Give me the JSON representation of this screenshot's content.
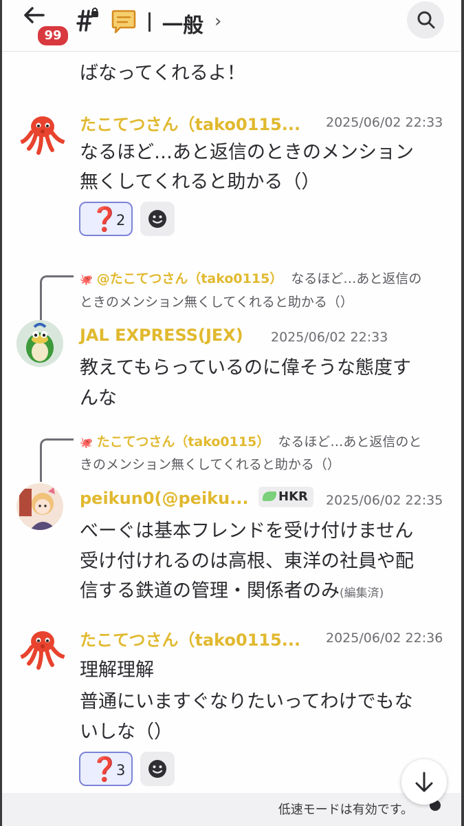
{
  "header": {
    "unread_badge": "99",
    "channel_name": "一般",
    "chevron": "›"
  },
  "messages": {
    "m0": {
      "tail": "ばなってくれるよ！"
    },
    "m1": {
      "username": "たこてつさん（tako0115...",
      "timestamp": "2025/06/02 22:33",
      "line1": "なるほど…あと返信のときのメンション",
      "line2": "無くしてくれると助かる（）",
      "reaction": {
        "emoji": "❓",
        "count": "2"
      }
    },
    "m2": {
      "reply": {
        "icon": "🐙",
        "name": "@たこてつさん（tako0115）",
        "text1": "なるほど…あと返信の",
        "text2": "ときのメンション無くしてくれると助かる（）"
      },
      "username": "JAL EXPRESS(JEX)",
      "timestamp": "2025/06/02 22:33",
      "line1": "教えてもらっているのに偉そうな態度す",
      "line2": "んな"
    },
    "m3": {
      "reply": {
        "icon": "🐙",
        "name": "たこてつさん（tako0115）",
        "text1": "なるほど…あと返信のと",
        "text2": "きのメンション無くしてくれると助かる（）"
      },
      "username": "peikun0(@peiku...",
      "role": "HKR",
      "timestamp": "2025/06/02 22:35",
      "line1": "べーぐは基本フレンドを受け付けません",
      "line2": "受け付けれるのは高根、東洋の社員や配",
      "line3": "信する鉄道の管理・関係者のみ",
      "edited": "(編集済)"
    },
    "m4": {
      "username": "たこてつさん（tako0115...",
      "timestamp": "2025/06/02 22:36",
      "line1": "理解理解",
      "line2": "普通にいますぐなりたいってわけでもな",
      "line3": "いしな（）",
      "reaction": {
        "emoji": "❓",
        "count": "3"
      }
    }
  },
  "footer": {
    "slow_mode": "低速モードは有効です。"
  },
  "colors": {
    "username": "#e1b92f",
    "badge": "#d8393f",
    "reaction_border": "#7b83d6",
    "reaction_bg": "#eaeefe"
  },
  "icons": [
    "back-arrow-icon",
    "hashtag-lock-icon",
    "chat-bubble-icon",
    "search-icon",
    "octopus-avatar-icon",
    "smiley-add-reaction-icon",
    "arrow-down-icon",
    "slow-mode-icon"
  ]
}
